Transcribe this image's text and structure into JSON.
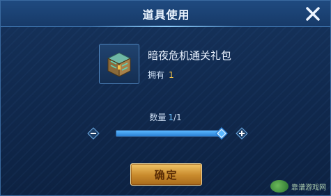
{
  "dialog": {
    "title": "道具使用",
    "close_icon": "close-icon"
  },
  "item": {
    "icon": "treasure-chest-icon",
    "name": "暗夜危机通关礼包",
    "owned_label": "拥有",
    "owned_count": "1"
  },
  "quantity": {
    "label": "数量",
    "current": "1",
    "total": "/1",
    "fraction": 1.0
  },
  "confirm_label": "确定",
  "watermark": {
    "text": "靠谱游戏网"
  },
  "colors": {
    "accent_blue": "#5ab7ff",
    "owned_gold": "#f1c24a",
    "button_gold": "#c88a2c"
  }
}
